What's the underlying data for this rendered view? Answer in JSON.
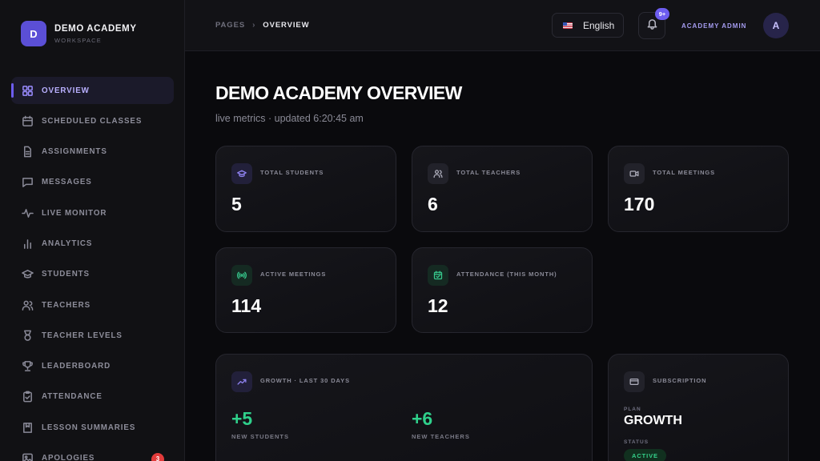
{
  "brand": {
    "logo_letter": "D",
    "name": "DEMO ACADEMY",
    "subtitle": "WORKSPACE"
  },
  "sidebar": {
    "items": [
      {
        "label": "OVERVIEW",
        "icon": "grid-icon",
        "active": true
      },
      {
        "label": "SCHEDULED CLASSES",
        "icon": "calendar-icon"
      },
      {
        "label": "ASSIGNMENTS",
        "icon": "document-icon"
      },
      {
        "label": "MESSAGES",
        "icon": "chat-icon"
      },
      {
        "label": "LIVE MONITOR",
        "icon": "pulse-icon"
      },
      {
        "label": "ANALYTICS",
        "icon": "bar-chart-icon"
      },
      {
        "label": "STUDENTS",
        "icon": "graduation-cap-icon"
      },
      {
        "label": "TEACHERS",
        "icon": "users-icon"
      },
      {
        "label": "TEACHER LEVELS",
        "icon": "medal-icon"
      },
      {
        "label": "LEADERBOARD",
        "icon": "trophy-icon"
      },
      {
        "label": "ATTENDANCE",
        "icon": "clipboard-check-icon"
      },
      {
        "label": "LESSON SUMMARIES",
        "icon": "book-icon"
      },
      {
        "label": "APOLOGIES",
        "icon": "image-icon",
        "badge": "3"
      }
    ]
  },
  "header": {
    "breadcrumb": [
      "PAGES",
      "OVERVIEW"
    ],
    "language": "English",
    "notifications_badge": "9+",
    "user_name": "ACADEMY ADMIN",
    "avatar_letter": "A"
  },
  "main": {
    "title": "DEMO ACADEMY OVERVIEW",
    "subtitle": "live metrics · updated 6:20:45 am",
    "stats": [
      {
        "label": "TOTAL STUDENTS",
        "value": "5",
        "icon": "graduation-cap-icon"
      },
      {
        "label": "TOTAL TEACHERS",
        "value": "6",
        "icon": "users-icon"
      },
      {
        "label": "TOTAL MEETINGS",
        "value": "170",
        "icon": "video-icon"
      },
      {
        "label": "ACTIVE MEETINGS",
        "value": "114",
        "icon": "broadcast-icon"
      },
      {
        "label": "ATTENDANCE (THIS MONTH)",
        "value": "12",
        "icon": "calendar-check-icon"
      }
    ],
    "growth": {
      "title": "GROWTH · LAST 30 DAYS",
      "new_students_value": "+5",
      "new_students_label": "NEW STUDENTS",
      "new_teachers_value": "+6",
      "new_teachers_label": "NEW TEACHERS"
    },
    "subscription": {
      "title": "SUBSCRIPTION",
      "plan_label": "PLAN",
      "plan_value": "GROWTH",
      "status_label": "STATUS",
      "status_value": "ACTIVE"
    }
  },
  "colors": {
    "accent": "#6d5df0",
    "success": "#2fd08b",
    "danger": "#e23b3b",
    "background": "#0a0a0d"
  }
}
